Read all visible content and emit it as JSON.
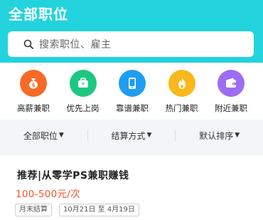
{
  "header": {
    "title": "全部职位",
    "search_placeholder": "搜索职位、雇主",
    "bg_color": "#22d3dd"
  },
  "categories": [
    {
      "label": "高薪兼职",
      "icon": "money-bag-icon",
      "color": "#f56a26"
    },
    {
      "label": "优先上岗",
      "icon": "briefcase-icon",
      "color": "#1dc782"
    },
    {
      "label": "靠谱兼职",
      "icon": "phone-icon",
      "color": "#1f9df2"
    },
    {
      "label": "热门兼职",
      "icon": "flame-icon",
      "color": "#f8b71c"
    },
    {
      "label": "附近兼职",
      "icon": "wallet-icon",
      "color": "#9c6df2"
    }
  ],
  "filters": [
    {
      "label": "全部职位"
    },
    {
      "label": "结算方式"
    },
    {
      "label": "默认排序"
    }
  ],
  "job": {
    "title": "推荐|从零学PS兼职赚钱",
    "salary": "100-500元/次",
    "tags": [
      "月末结算",
      "10月21日 至 4月19日"
    ],
    "salary_color": "#f25430"
  }
}
